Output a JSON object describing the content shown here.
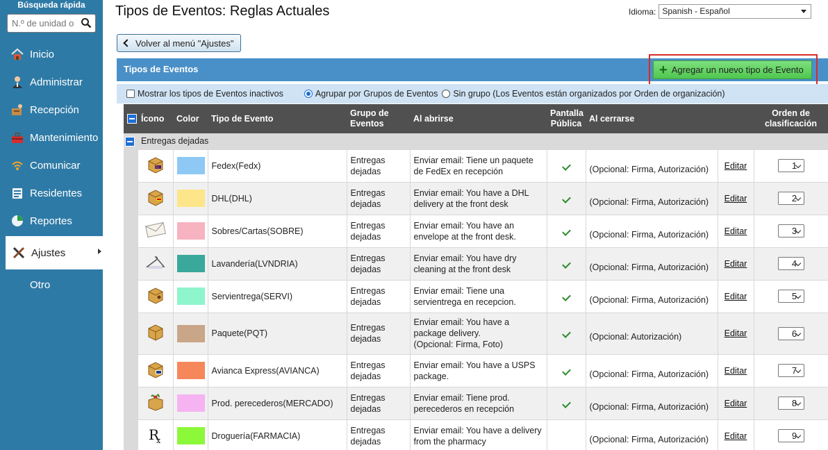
{
  "sidebar": {
    "quick_search_title": "Búsqueda rápida",
    "quick_search_placeholder": "N.º de unidad o",
    "items": [
      {
        "label": "Inicio"
      },
      {
        "label": "Administrar"
      },
      {
        "label": "Recepción"
      },
      {
        "label": "Mantenimiento"
      },
      {
        "label": "Comunicar"
      },
      {
        "label": "Residentes"
      },
      {
        "label": "Reportes"
      },
      {
        "label": "Ajustes"
      },
      {
        "label": "Otro"
      }
    ]
  },
  "header": {
    "title": "Tipos de Eventos: Reglas Actuales",
    "idioma_label": "Idioma:",
    "idioma_value": "Spanish - Español"
  },
  "back_button": "Volver al menú \"Ajustes\"",
  "panel": {
    "title": "Tipos de Eventos",
    "add_button": "Agregar un nuevo tipo de Evento"
  },
  "filters": {
    "show_inactive": "Mostrar los tipos de Eventos inactivos",
    "group_by": "Agrupar por Grupos de Eventos",
    "no_group": "Sin grupo (Los Eventos están organizados por Orden de organización)"
  },
  "table": {
    "headers": {
      "icon": "Ícono",
      "color": "Color",
      "type": "Tipo de Evento",
      "group": "Grupo de Eventos",
      "on_open": "Al abrirse",
      "public": "Pantalla Pública",
      "on_close": "Al cerrarse",
      "order": "Orden de clasificación"
    },
    "group_name": "Entregas dejadas",
    "edit_label": "Editar",
    "rows": [
      {
        "icon": "fedex-package-icon",
        "color": "#8ec9f5",
        "type": "Fedex(Fedx)",
        "group": "Entregas dejadas",
        "open": "Enviar email: Tiene un paquete de FedEx en recepción",
        "public": true,
        "close": "(Opcional: Firma, Autorización)",
        "order": "1"
      },
      {
        "icon": "dhl-package-icon",
        "color": "#fde58a",
        "type": "DHL(DHL)",
        "group": "Entregas dejadas",
        "open": "Enviar email: You have a DHL delivery at the front desk",
        "public": true,
        "close": "(Opcional: Firma, Autorización)",
        "order": "2"
      },
      {
        "icon": "envelope-icon",
        "color": "#f7b3c0",
        "type": "Sobres/Cartas(SOBRE)",
        "group": "Entregas dejadas",
        "open": "Enviar email: You have an envelope at the front desk.",
        "public": true,
        "close": "(Opcional: Firma, Autorización)",
        "order": "3"
      },
      {
        "icon": "hanger-icon",
        "color": "#3aa89a",
        "type": "Lavandería(LVNDRIA)",
        "group": "Entregas dejadas",
        "open": "Enviar email: You have dry cleaning at the front desk",
        "public": true,
        "close": "(Opcional: Firma, Autorización)",
        "order": "4"
      },
      {
        "icon": "package-icon",
        "color": "#8ff5cc",
        "type": "Servientrega(SERVI)",
        "group": "Entregas dejadas",
        "open": "Enviar email: Tiene una servientrega en recepcion.",
        "public": true,
        "close": "(Opcional: Firma, Autorización)",
        "order": "5"
      },
      {
        "icon": "box-icon",
        "color": "#c9a688",
        "type": "Paquete(PQT)",
        "group": "Entregas dejadas",
        "open": "Enviar email: You have a package delivery.\n(Opcional: Firma, Foto)",
        "public": true,
        "close": "(Opcional: Autorización)",
        "order": "6"
      },
      {
        "icon": "usps-package-icon",
        "color": "#f6875a",
        "type": "Avianca Express(AVIANCA)",
        "group": "Entregas dejadas",
        "open": "Enviar email: You have a USPS package.",
        "public": true,
        "close": "(Opcional: Firma, Autorización)",
        "order": "7"
      },
      {
        "icon": "grocery-box-icon",
        "color": "#f6b3f2",
        "type": "Prod. perecederos(MERCADO)",
        "group": "Entregas dejadas",
        "open": "Enviar email: Tiene prod. perecederos en recepción",
        "public": true,
        "close": "(Opcional: Firma, Autorización)",
        "order": "8"
      },
      {
        "icon": "rx-icon",
        "color": "#8cf83a",
        "type": "Droguería(FARMACIA)",
        "group": "Entregas dejadas",
        "open": "Enviar email: You have a delivery from the pharmacy",
        "public": false,
        "close": "(Opcional: Firma, Autorización)",
        "order": "9"
      }
    ]
  }
}
